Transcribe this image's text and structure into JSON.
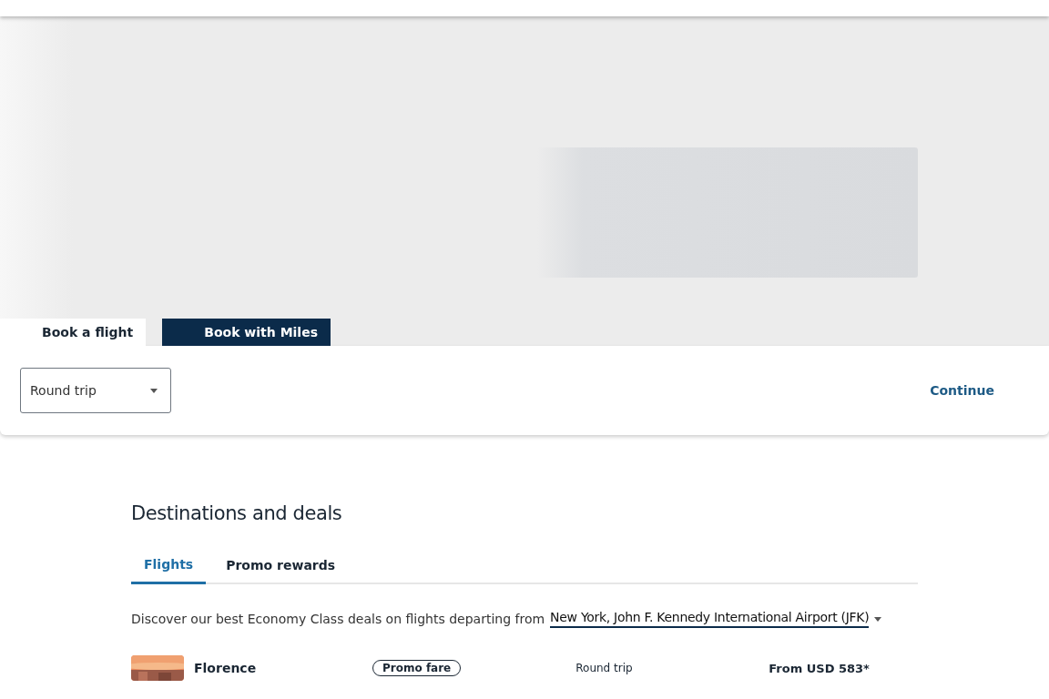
{
  "booking_tabs": [
    {
      "label": "Book a flight",
      "selected": true
    },
    {
      "label": "Book with Miles",
      "selected": false
    }
  ],
  "trip_type": {
    "value": "Round trip"
  },
  "continue_button": "Continue",
  "deals": {
    "title": "Destinations and deals",
    "tabs": [
      {
        "label": "Flights",
        "selected": true
      },
      {
        "label": "Promo rewards",
        "selected": false
      }
    ],
    "intro": "Discover our best Economy Class deals on flights departing from",
    "origin": "New York, John F. Kennedy International Airport (JFK)",
    "items": [
      {
        "city": "Florence",
        "kind": "picture",
        "badge": "Promo fare",
        "trip": "Round trip",
        "price": "From USD 583*"
      }
    ]
  }
}
